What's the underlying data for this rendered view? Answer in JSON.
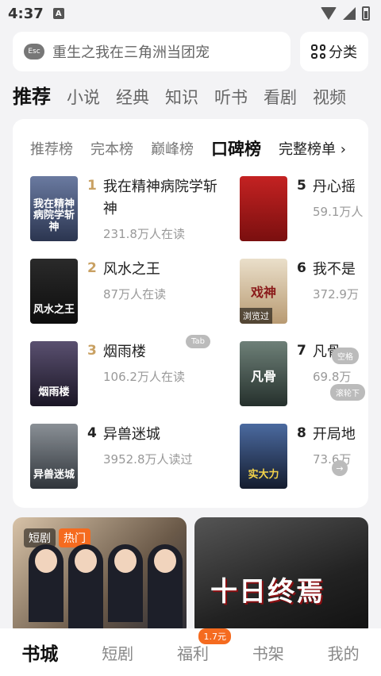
{
  "status": {
    "time": "4:37",
    "badge": "A"
  },
  "search": {
    "placeholder": "重生之我在三角洲当团宠",
    "esc": "Esc",
    "category": "分类"
  },
  "channels": [
    "推荐",
    "小说",
    "经典",
    "知识",
    "听书",
    "看剧",
    "视频"
  ],
  "rank_tabs": [
    "推荐榜",
    "完本榜",
    "巅峰榜",
    "口碑榜",
    "完整榜单 ›"
  ],
  "books_left": [
    {
      "rank": "1",
      "title": "我在精神病院学斩神",
      "meta": "231.8万人在读",
      "cover_text": "我在精神病院学斩神",
      "color": "#3a4b6a"
    },
    {
      "rank": "2",
      "title": "风水之王",
      "meta": "87万人在读",
      "cover_text": "风水之王",
      "color": "#1b1b1b"
    },
    {
      "rank": "3",
      "title": "烟雨楼",
      "meta": "106.2万人在读",
      "cover_text": "烟雨楼",
      "color": "#2a2438"
    },
    {
      "rank": "4",
      "title": "异兽迷城",
      "meta": "3952.8万人读过",
      "cover_text": "异兽迷城",
      "color": "#4a5058"
    }
  ],
  "books_right": [
    {
      "rank": "5",
      "title": "丹心摇",
      "meta": "59.1万人",
      "cover_text": "",
      "color": "#b01d1d"
    },
    {
      "rank": "6",
      "title": "我不是",
      "meta": "372.9万",
      "cover_text": "戏神",
      "tag": "浏览过",
      "color": "#d8c3a3"
    },
    {
      "rank": "7",
      "title": "凡骨",
      "meta": "69.8万",
      "cover_text": "凡骨",
      "color": "#3f4f4a"
    },
    {
      "rank": "8",
      "title": "开局地",
      "meta": "73.6万",
      "cover_text": "实大力",
      "color": "#24324d"
    }
  ],
  "overlays": {
    "tab": "Tab",
    "space": "空格",
    "scroll": "滚轮下"
  },
  "promo": {
    "left_tags": [
      "短剧",
      "热门"
    ],
    "right_title": "十日终焉"
  },
  "bottom_nav": [
    "书城",
    "短剧",
    "福利",
    "书架",
    "我的"
  ],
  "bottom_badge": "1.7元"
}
